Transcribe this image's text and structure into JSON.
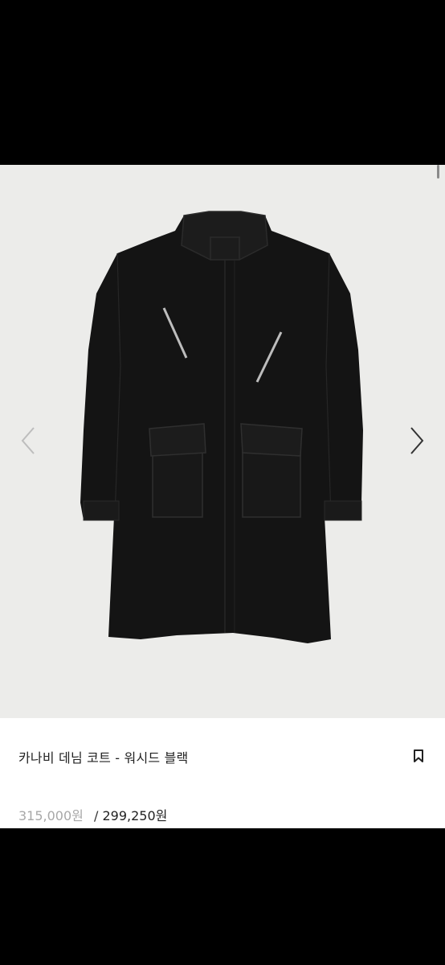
{
  "product": {
    "title": "카나비 데님 코트 - 워시드 블랙",
    "original_price": "315,000원",
    "separator": "/",
    "sale_price": "299,250원"
  },
  "gallery": {
    "image_subject": "black-denim-coat",
    "prev_icon": "chevron-left-icon",
    "next_icon": "chevron-right-icon"
  },
  "icons": {
    "bookmark": "bookmark-icon"
  },
  "colors": {
    "gallery_bg": "#ececea",
    "coat": "#141414",
    "original_price": "#a8a8a8"
  }
}
